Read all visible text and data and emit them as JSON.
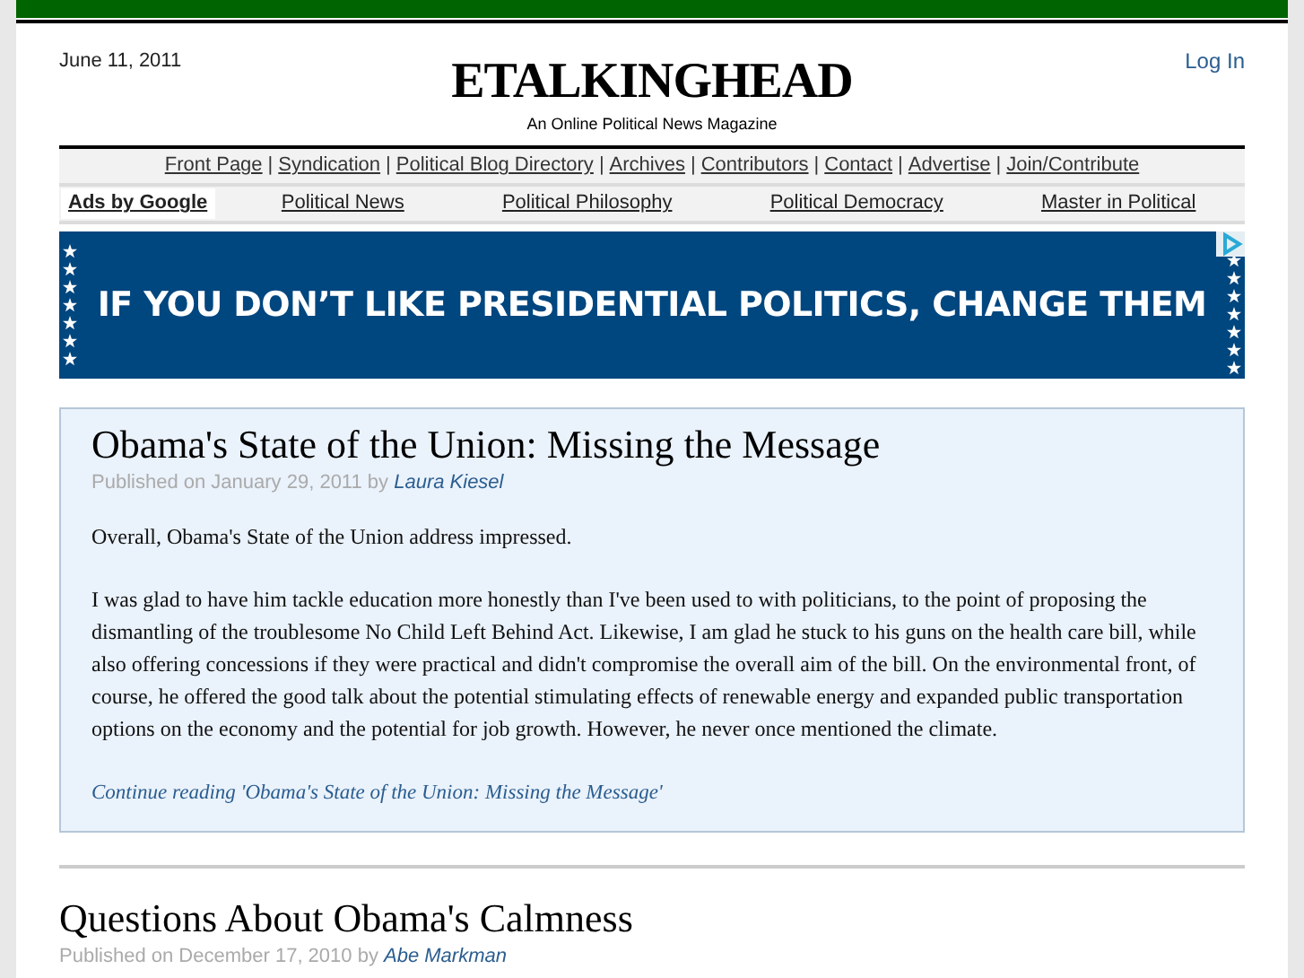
{
  "header": {
    "date": "June 11, 2011",
    "login": "Log In",
    "site_title": "ETALKINGHEAD",
    "tagline": "An Online Political News Magazine"
  },
  "nav": {
    "separator": "|",
    "links": [
      "Front Page",
      "Syndication",
      "Political Blog Directory",
      "Archives",
      "Contributors",
      "Contact",
      "Advertise",
      "Join/Contribute"
    ]
  },
  "ad_links": {
    "label": "Ads by Google",
    "links": [
      "Political News",
      "Political Philosophy",
      "Political Democracy",
      "Master in Political"
    ]
  },
  "banner": {
    "text": "IF YOU DON’T LIKE PRESIDENTIAL POLITICS, CHANGE THEM"
  },
  "posts": [
    {
      "title": "Obama's State of the Union: Missing the Message",
      "published": "Published on January 29, 2011 by",
      "author": "Laura Kiesel",
      "paragraphs": [
        "Overall, Obama's State of the Union address impressed.",
        "I was glad to have him tackle education more honestly than I've been used to with politicians, to the point of proposing the dismantling of the troublesome No Child Left Behind Act. Likewise, I am glad he stuck to his guns on the health care bill, while also offering concessions if they were practical and didn't compromise the overall aim of the bill. On the environmental front, of course, he offered the good talk about the potential stimulating effects of renewable energy and expanded public transportation options on the economy and the potential for job growth. However, he never once mentioned the climate."
      ],
      "continue": "Continue reading 'Obama's State of the Union: Missing the Message'"
    },
    {
      "title": "Questions About Obama's Calmness",
      "published": "Published on December 17, 2010 by",
      "author": "Abe Markman"
    }
  ]
}
